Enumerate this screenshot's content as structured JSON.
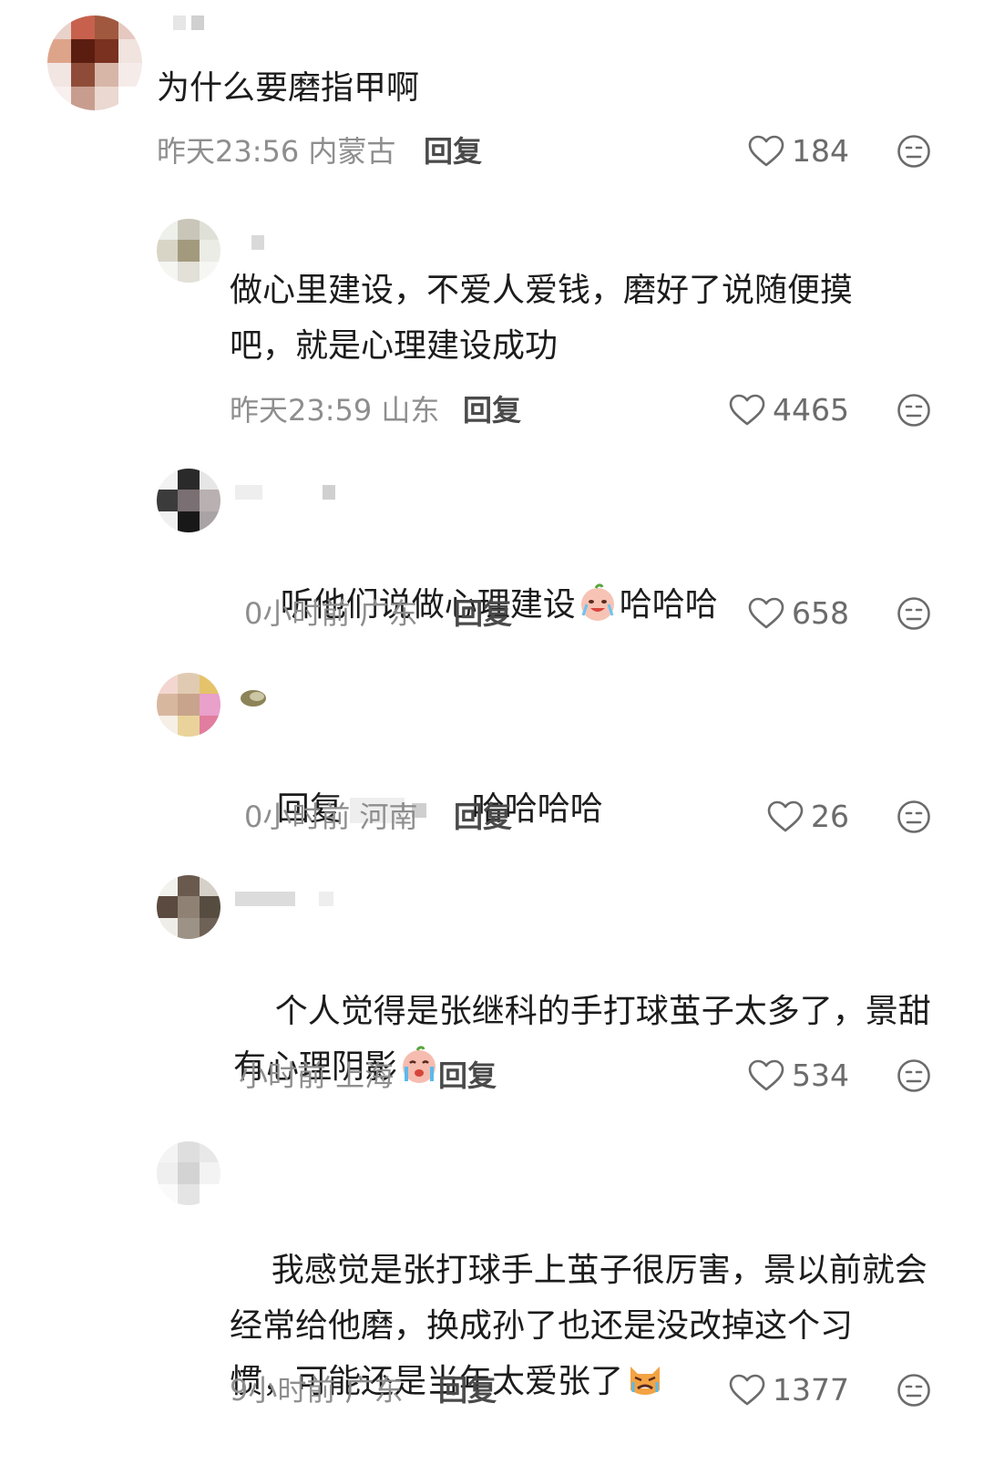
{
  "comments": [
    {
      "text": "为什么要磨指甲啊",
      "meta": "昨天23:56 内蒙古",
      "reply_label": "回复",
      "likes": "184"
    },
    {
      "text": "做心里建设，不爱人爱钱，磨好了说随便摸\n吧，就是心理建设成功",
      "meta": "昨天23:59 山东",
      "reply_label": "回复",
      "likes": "4465"
    },
    {
      "text_before": "听他们说做心理建设",
      "text_after": "哈哈哈",
      "emoji": "crying-laughing-emoji",
      "meta": "0小时前 广东",
      "reply_label": "回复",
      "likes": "658"
    },
    {
      "text_prefix": "回复",
      "text": "哈哈哈哈",
      "meta": "0小时前 河南",
      "reply_label": "回复",
      "likes": "26"
    },
    {
      "text": "个人觉得是张继科的手打球茧子太多了，景甜\n有心理阴影",
      "emoji": "crying-emoji",
      "meta": "小时前 上海",
      "reply_label": "回复",
      "likes": "534"
    },
    {
      "text": "我感觉是张打球手上茧子很厉害，景以前就会\n经常给他磨，换成孙了也还是没改掉这个习\n惯，可能还是当年太爱张了",
      "emoji": "crying-cat-emoji",
      "meta": "9小时前 广东",
      "reply_label": "回复",
      "likes": "1377"
    }
  ],
  "icons": {
    "like": "heart-outline-icon",
    "dislike": "meh-face-icon"
  },
  "colors": {
    "text": "#1c1c1c",
    "meta": "#8e8e8e",
    "icon": "#6b6b6b"
  }
}
